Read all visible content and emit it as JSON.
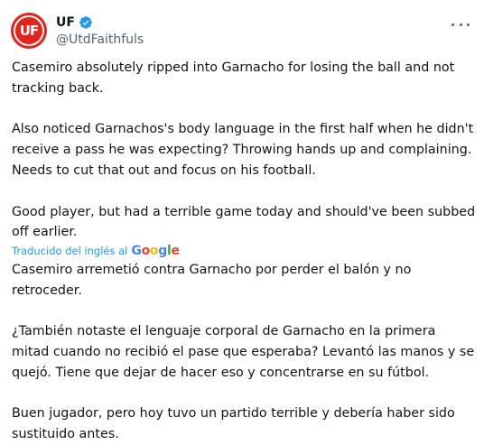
{
  "author": {
    "avatar_text": "UF",
    "display_name": "UF",
    "handle": "@UtdFaithfuls",
    "verified": true,
    "brand_color": "#e5231b",
    "verified_color": "#1d9bf0"
  },
  "tweet": {
    "paragraphs": [
      "Casemiro absolutely ripped into Garnacho for losing the ball and not tracking back.",
      "Also noticed Garnachos's body language in the first half when he didn't receive a pass he was expecting? Throwing hands up and complaining. Needs to cut that out and focus on his football.",
      "Good player, but had a terrible game today and should've been subbed off earlier."
    ]
  },
  "translation": {
    "label": "Traducido del inglés al",
    "provider_letters": [
      "G",
      "o",
      "o",
      "g",
      "l",
      "e"
    ],
    "paragraphs": [
      "Casemiro arremetió contra Garnacho por perder el balón y no retroceder.",
      "¿También notaste el lenguaje corporal de Garnacho en la primera mitad cuando no recibió el pase que esperaba? Levantó las manos y se quejó. Tiene que dejar de hacer eso y concentrarse en su fútbol.",
      "Buen jugador, pero hoy tuvo un partido terrible y debería haber sido sustituido antes."
    ]
  },
  "icons": {
    "more": "more-horizontal-icon",
    "verified": "verified-badge-icon"
  }
}
